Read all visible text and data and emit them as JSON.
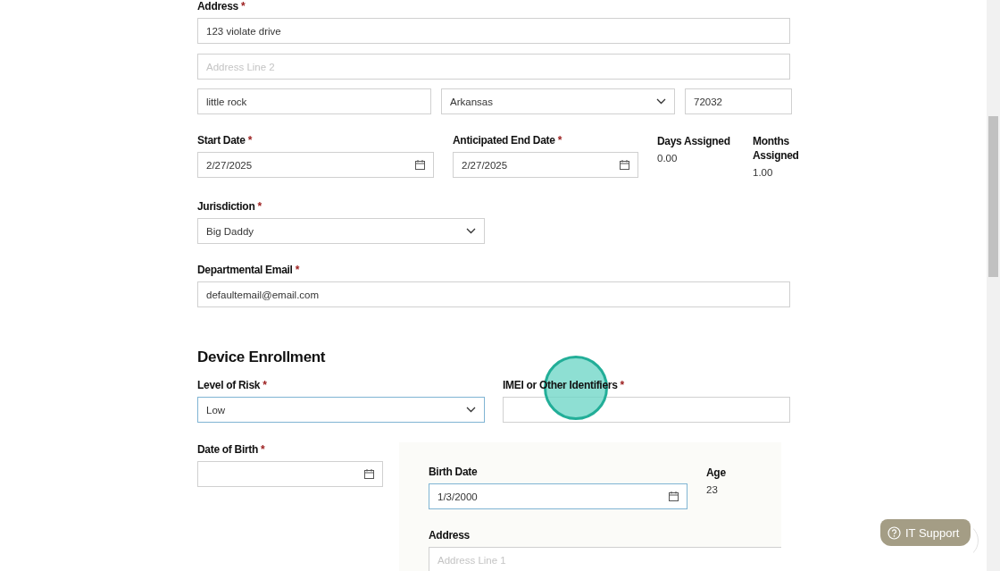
{
  "required_mark": "*",
  "address": {
    "label": "Address",
    "required": true,
    "line1": {
      "value": "123 violate drive"
    },
    "line2": {
      "placeholder": "Address Line 2"
    },
    "city": {
      "value": "little rock"
    },
    "state": {
      "value": "Arkansas"
    },
    "zip": {
      "value": "72032"
    }
  },
  "start_date": {
    "label": "Start Date",
    "required": true,
    "value": "2/27/2025"
  },
  "end_date": {
    "label": "Anticipated End Date",
    "required": true,
    "value": "2/27/2025"
  },
  "days_assigned": {
    "label": "Days Assigned",
    "value": "0.00"
  },
  "months_assigned": {
    "label": "Months Assigned",
    "value": "1.00"
  },
  "jurisdiction": {
    "label": "Jurisdiction",
    "required": true,
    "value": "Big Daddy"
  },
  "email": {
    "label": "Departmental Email",
    "required": true,
    "value": "defaultemail@email.com"
  },
  "device_enrollment": {
    "heading": "Device Enrollment",
    "level_of_risk": {
      "label": "Level of Risk",
      "required": true,
      "value": "Low",
      "focused": true
    },
    "imei": {
      "label": "IMEI or Other Identifiers",
      "required": true
    },
    "date_of_birth": {
      "label": "Date of Birth",
      "required": true
    }
  },
  "inset": {
    "birth_date": {
      "label": "Birth Date",
      "value": "1/3/2000",
      "focused": true
    },
    "age": {
      "label": "Age",
      "value": "23"
    },
    "address": {
      "label": "Address",
      "placeholder": "Address Line 1"
    }
  },
  "it_support": {
    "label": "IT Support"
  }
}
